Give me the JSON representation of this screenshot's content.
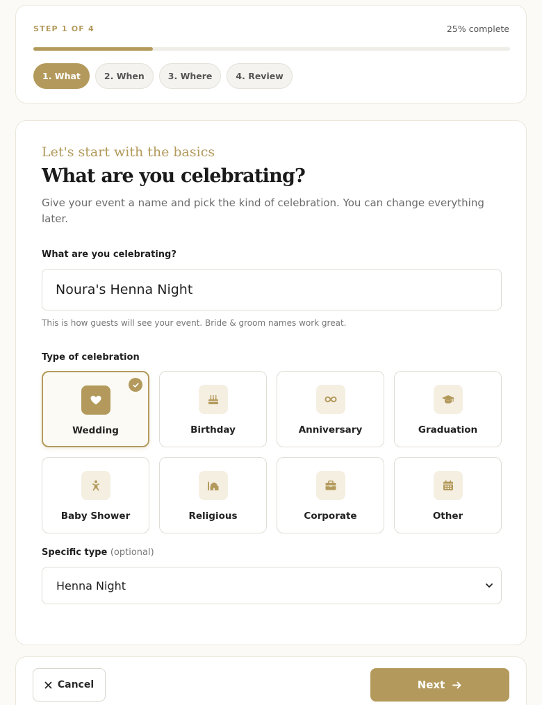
{
  "progress": {
    "step_label": "STEP 1 OF 4",
    "percent_label": "25% complete",
    "percent_value": 25,
    "steps": [
      {
        "label": "1. What",
        "active": true
      },
      {
        "label": "2. When",
        "active": false
      },
      {
        "label": "3. Where",
        "active": false
      },
      {
        "label": "4. Review",
        "active": false
      }
    ]
  },
  "form": {
    "eyebrow": "Let's start with the basics",
    "headline": "What are you celebrating?",
    "intro": "Give your event a name and pick the kind of celebration. You can change everything later.",
    "name_field": {
      "label": "What are you celebrating?",
      "value": "Noura's Henna Night",
      "hint": "This is how guests will see your event. Bride & groom names work great."
    },
    "type_field": {
      "label": "Type of celebration",
      "options": [
        {
          "label": "Wedding",
          "icon": "heart-icon",
          "selected": true
        },
        {
          "label": "Birthday",
          "icon": "cake-icon",
          "selected": false
        },
        {
          "label": "Anniversary",
          "icon": "infinity-icon",
          "selected": false
        },
        {
          "label": "Graduation",
          "icon": "graduation-cap-icon",
          "selected": false
        },
        {
          "label": "Baby Shower",
          "icon": "baby-icon",
          "selected": false
        },
        {
          "label": "Religious",
          "icon": "mosque-icon",
          "selected": false
        },
        {
          "label": "Corporate",
          "icon": "briefcase-icon",
          "selected": false
        },
        {
          "label": "Other",
          "icon": "calendar-icon",
          "selected": false
        }
      ]
    },
    "specific_type": {
      "label": "Specific type",
      "optional": "(optional)",
      "value": "Henna Night"
    }
  },
  "footer": {
    "cancel_label": "Cancel",
    "next_label": "Next"
  },
  "colors": {
    "accent": "#b39a5c",
    "accent_light": "#f5efe2",
    "background": "#fbfaf6"
  }
}
